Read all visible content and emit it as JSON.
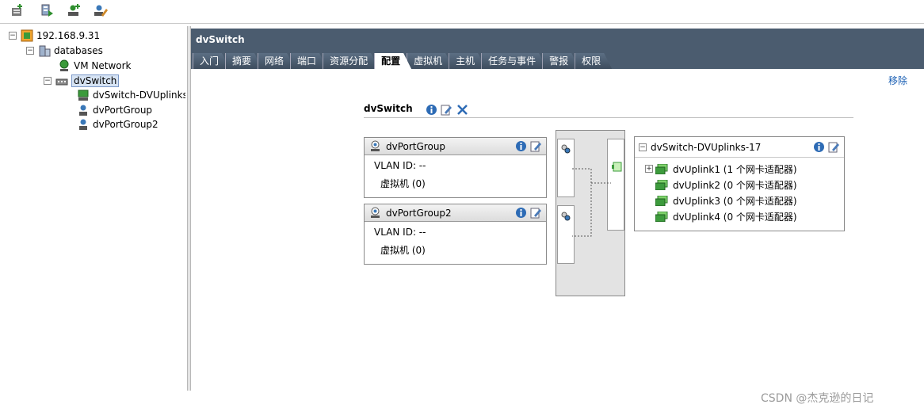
{
  "toolbar": {
    "buttons": [
      "add-host-icon",
      "new-datacenter-icon",
      "add-user-icon",
      "permissions-icon"
    ]
  },
  "tree": {
    "root": "192.168.9.31",
    "datacenter": "databases",
    "vm_network": "VM Network",
    "dvswitch": "dvSwitch",
    "uplinks": "dvSwitch-DVUplinks",
    "portgroup1": "dvPortGroup",
    "portgroup2": "dvPortGroup2"
  },
  "header": {
    "title": "dvSwitch",
    "tabs": [
      "入门",
      "摘要",
      "网络",
      "端口",
      "资源分配",
      "配置",
      "虚拟机",
      "主机",
      "任务与事件",
      "警报",
      "权限"
    ],
    "active_tab": "配置"
  },
  "actions": {
    "remove": "移除"
  },
  "diagram": {
    "switch_title": "dvSwitch",
    "portgroups": [
      {
        "name": "dvPortGroup",
        "vlan": "VLAN ID: --",
        "vms": "虚拟机 (0)"
      },
      {
        "name": "dvPortGroup2",
        "vlan": "VLAN ID: --",
        "vms": "虚拟机 (0)"
      }
    ],
    "uplink_group": {
      "name": "dvSwitch-DVUplinks-17",
      "uplinks": [
        "dvUplink1 (1 个网卡适配器)",
        "dvUplink2 (0 个网卡适配器)",
        "dvUplink3 (0 个网卡适配器)",
        "dvUplink4 (0 个网卡适配器)"
      ]
    }
  },
  "watermark": "CSDN @杰克逊的日记",
  "colors": {
    "header_bg": "#4b5c6f",
    "link": "#1a5fb4",
    "nic_green": "#3d9b3d"
  }
}
